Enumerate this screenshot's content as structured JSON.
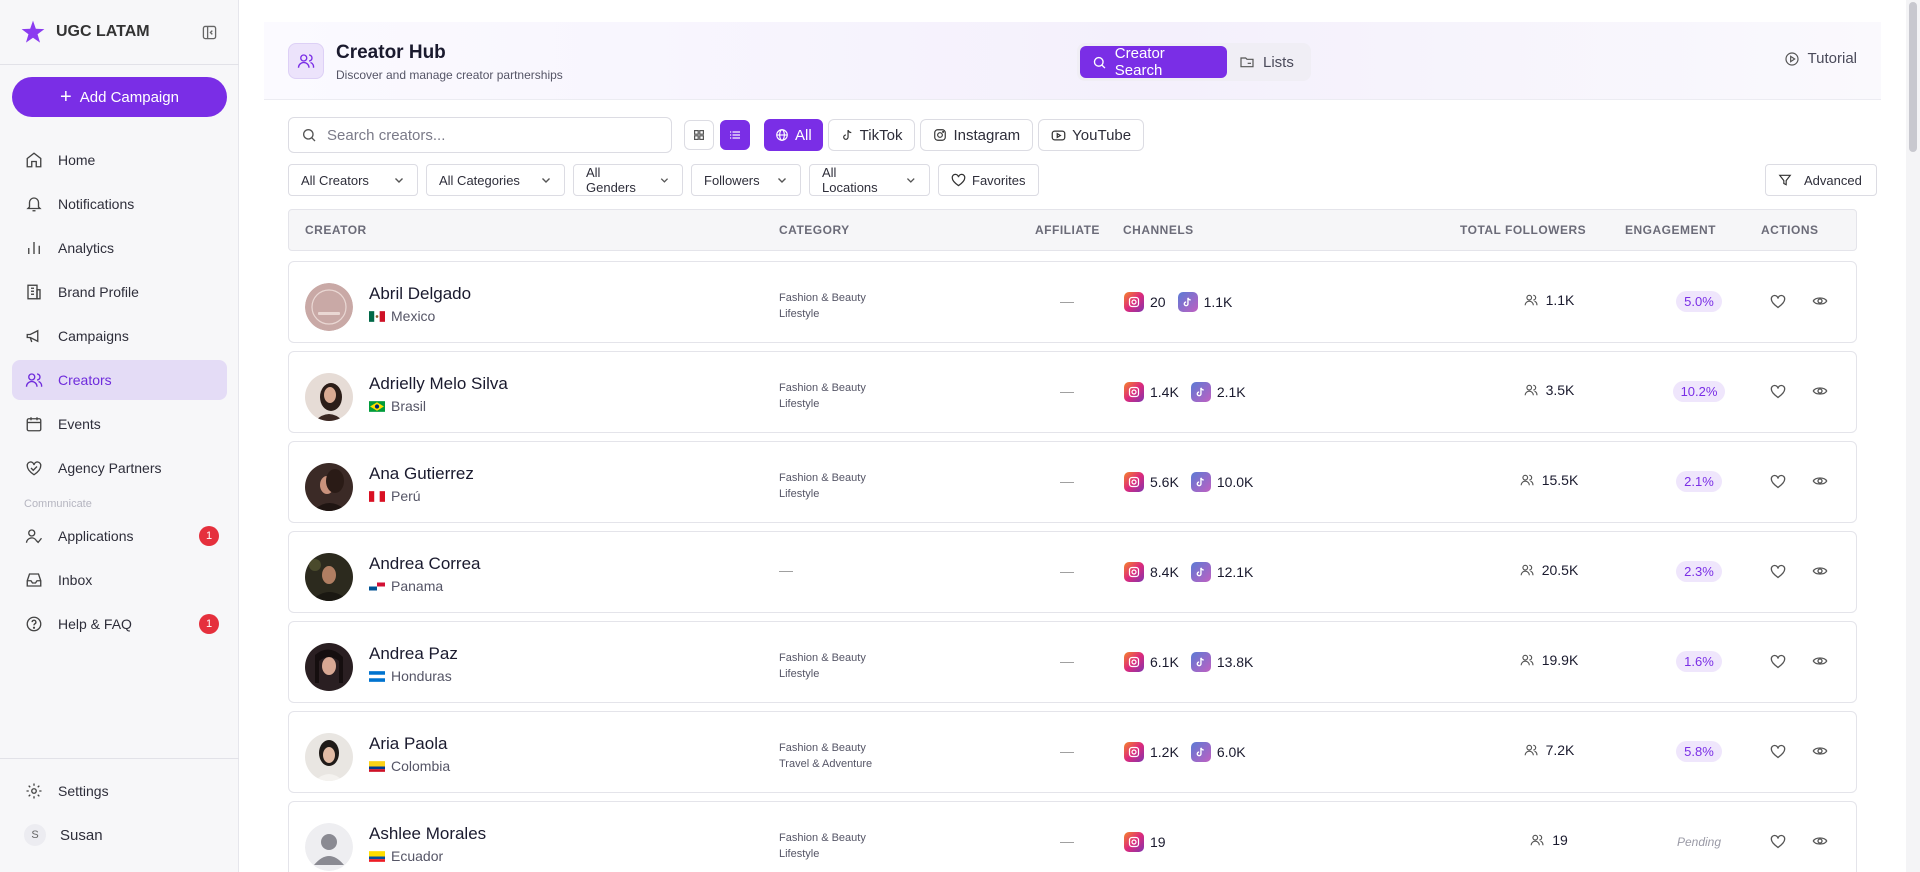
{
  "sidebar": {
    "brand": "UGC LATAM",
    "add_campaign": "Add Campaign",
    "items": [
      {
        "label": "Home",
        "icon": "home-icon"
      },
      {
        "label": "Notifications",
        "icon": "bell-icon"
      },
      {
        "label": "Analytics",
        "icon": "bar-chart-icon"
      },
      {
        "label": "Brand Profile",
        "icon": "building-icon"
      },
      {
        "label": "Campaigns",
        "icon": "megaphone-icon"
      },
      {
        "label": "Creators",
        "icon": "users-icon",
        "active": true
      },
      {
        "label": "Events",
        "icon": "calendar-icon"
      },
      {
        "label": "Agency Partners",
        "icon": "handshake-icon"
      }
    ],
    "section_label": "Communicate",
    "comm_items": [
      {
        "label": "Applications",
        "badge": "1"
      },
      {
        "label": "Inbox"
      },
      {
        "label": "Help & FAQ",
        "badge": "1"
      }
    ],
    "settings": "Settings",
    "user_initial": "S",
    "user_name": "Susan"
  },
  "header": {
    "title": "Creator Hub",
    "subtitle": "Discover and manage creator partnerships",
    "tab_search": "Creator Search",
    "tab_lists": "Lists",
    "tutorial": "Tutorial"
  },
  "toolbar": {
    "search_placeholder": "Search creators...",
    "platforms": [
      "All",
      "TikTok",
      "Instagram",
      "YouTube"
    ]
  },
  "filters": {
    "creators": "All Creators",
    "categories": "All Categories",
    "genders": "All Genders",
    "followers": "Followers",
    "locations": "All Locations",
    "favorites": "Favorites",
    "advanced": "Advanced"
  },
  "table": {
    "headers": {
      "creator": "CREATOR",
      "category": "CATEGORY",
      "affiliate": "AFFILIATE",
      "channels": "CHANNELS",
      "total_followers": "TOTAL FOLLOWERS",
      "engagement": "ENGAGEMENT",
      "actions": "ACTIONS"
    },
    "rows": [
      {
        "name": "Abril Delgado",
        "country": "Mexico",
        "cat1": "Fashion & Beauty",
        "cat2": "Lifestyle",
        "affiliate": "—",
        "ig": "20",
        "tt": "1.1K",
        "total": "1.1K",
        "engagement": "5.0%"
      },
      {
        "name": "Adrielly Melo Silva",
        "country": "Brasil",
        "cat1": "Fashion & Beauty",
        "cat2": "Lifestyle",
        "affiliate": "—",
        "ig": "1.4K",
        "tt": "2.1K",
        "total": "3.5K",
        "engagement": "10.2%"
      },
      {
        "name": "Ana Gutierrez",
        "country": "Perú",
        "cat1": "Fashion & Beauty",
        "cat2": "Lifestyle",
        "affiliate": "—",
        "ig": "5.6K",
        "tt": "10.0K",
        "total": "15.5K",
        "engagement": "2.1%"
      },
      {
        "name": "Andrea Correa",
        "country": "Panama",
        "cat1": "—",
        "cat2": "",
        "affiliate": "—",
        "ig": "8.4K",
        "tt": "12.1K",
        "total": "20.5K",
        "engagement": "2.3%"
      },
      {
        "name": "Andrea Paz",
        "country": "Honduras",
        "cat1": "Fashion & Beauty",
        "cat2": "Lifestyle",
        "affiliate": "—",
        "ig": "6.1K",
        "tt": "13.8K",
        "total": "19.9K",
        "engagement": "1.6%"
      },
      {
        "name": "Aria Paola",
        "country": "Colombia",
        "cat1": "Fashion & Beauty",
        "cat2": "Travel & Adventure",
        "affiliate": "—",
        "ig": "1.2K",
        "tt": "6.0K",
        "total": "7.2K",
        "engagement": "5.8%"
      },
      {
        "name": "Ashlee Morales",
        "country": "Ecuador",
        "cat1": "Fashion & Beauty",
        "cat2": "Lifestyle",
        "affiliate": "—",
        "ig": "19",
        "tt": "",
        "total": "19",
        "engagement": "Pending"
      }
    ]
  },
  "colors": {
    "accent": "#7a2ee6",
    "badge": "#e5303d"
  }
}
